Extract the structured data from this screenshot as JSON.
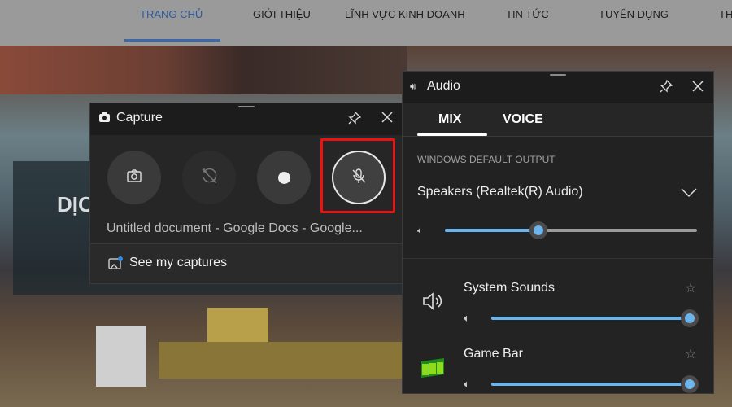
{
  "nav": {
    "items": [
      {
        "label": "TRANG CHỦ",
        "active": true
      },
      {
        "label": "GIỚI THIỆU"
      },
      {
        "label": "LĨNH VỰC KINH DOANH"
      },
      {
        "label": "TIN TỨC"
      },
      {
        "label": "TUYỂN DỤNG"
      },
      {
        "label": "TH"
      }
    ]
  },
  "hero": {
    "text": "DỊC"
  },
  "capture": {
    "title": "Capture",
    "icon": "camera-icon",
    "buttons": [
      {
        "name": "screenshot",
        "icon": "camera-icon"
      },
      {
        "name": "record-last-30s",
        "icon": "replay-disabled-icon"
      },
      {
        "name": "start-recording",
        "icon": "record-dot-icon"
      },
      {
        "name": "mic-toggle",
        "icon": "mic-off-icon",
        "highlighted": true
      }
    ],
    "source": "Untitled document - Google Docs - Google...",
    "see_captures": "See my captures",
    "highlight_color": "#ee1111"
  },
  "audio": {
    "title": "Audio",
    "tabs": [
      {
        "label": "MIX",
        "active": true
      },
      {
        "label": "VOICE"
      }
    ],
    "output_heading": "WINDOWS DEFAULT OUTPUT",
    "device": "Speakers (Realtek(R) Audio)",
    "master_volume": 37,
    "apps": [
      {
        "name": "System Sounds",
        "icon": "speaker-icon",
        "volume": 100
      },
      {
        "name": "Game Bar",
        "icon": "game-bar-icon",
        "volume": 100
      }
    ],
    "accent": "#6cb4ec"
  }
}
